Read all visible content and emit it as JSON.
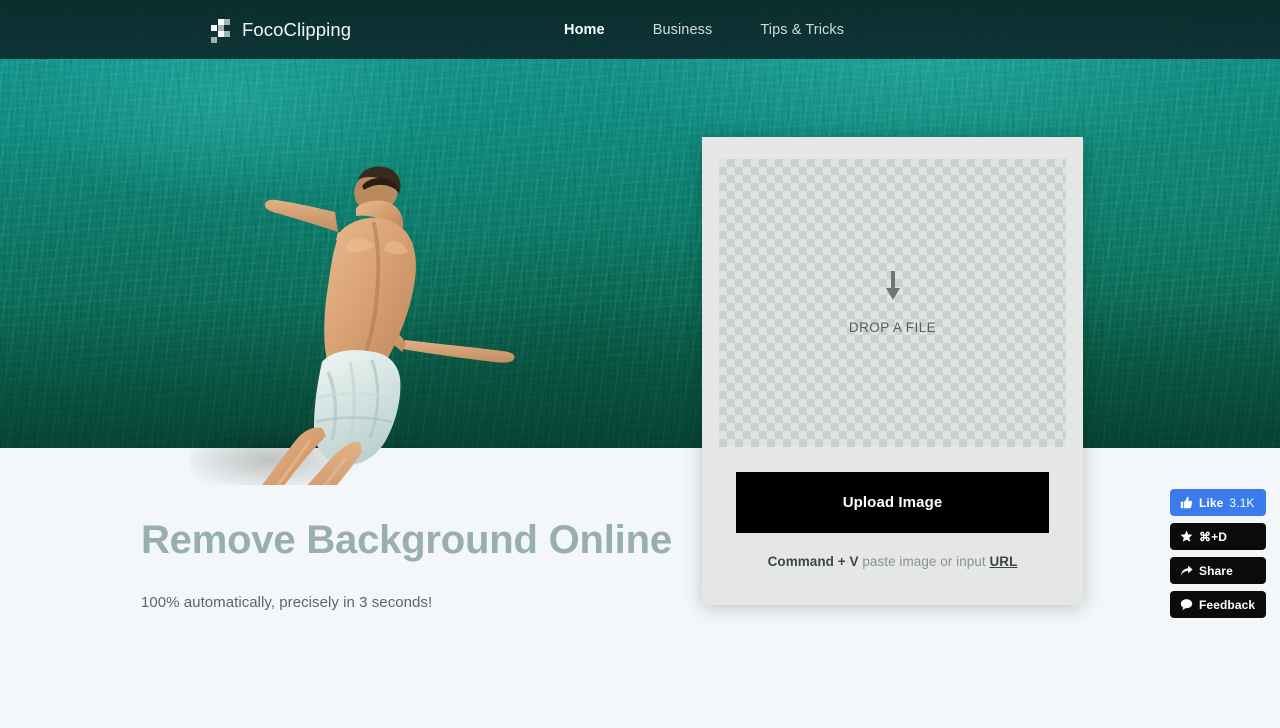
{
  "header": {
    "brand_name": "FocoClipping",
    "logo_icon": "checkerboard-logo-icon",
    "nav": [
      {
        "label": "Home",
        "active": true
      },
      {
        "label": "Business",
        "active": false
      },
      {
        "label": "Tips & Tricks",
        "active": false
      }
    ]
  },
  "hero": {
    "photo_alt": "man diving into turquoise ocean water",
    "headline": "Remove Background Online",
    "subheadline": "100% automatically, precisely in 3 seconds!"
  },
  "upload_card": {
    "dropzone": {
      "icon": "download-arrow-icon",
      "label": "DROP A FILE"
    },
    "upload_button_label": "Upload Image",
    "paste_hint": {
      "shortcut": "Command + V",
      "middle": " paste image or input ",
      "link_label": "URL"
    }
  },
  "social_widget": [
    {
      "id": "like",
      "icon": "thumbs-up-icon",
      "label": "Like",
      "count": "3.1K",
      "color": "#3a7bed"
    },
    {
      "id": "bookmark",
      "icon": "star-icon",
      "label": "⌘+D",
      "count": "",
      "color": "#0b0b0b"
    },
    {
      "id": "share",
      "icon": "share-arrow-icon",
      "label": "Share",
      "count": "",
      "color": "#0b0b0b"
    },
    {
      "id": "feedback",
      "icon": "speech-bubble-icon",
      "label": "Feedback",
      "count": "",
      "color": "#0b0b0b"
    }
  ],
  "colors": {
    "header_bg": "#0a2426",
    "accent_blue": "#3a7bed",
    "page_bg": "#f4f7f9",
    "headline_color": "#98afae",
    "card_bg": "#e4e7e6"
  }
}
